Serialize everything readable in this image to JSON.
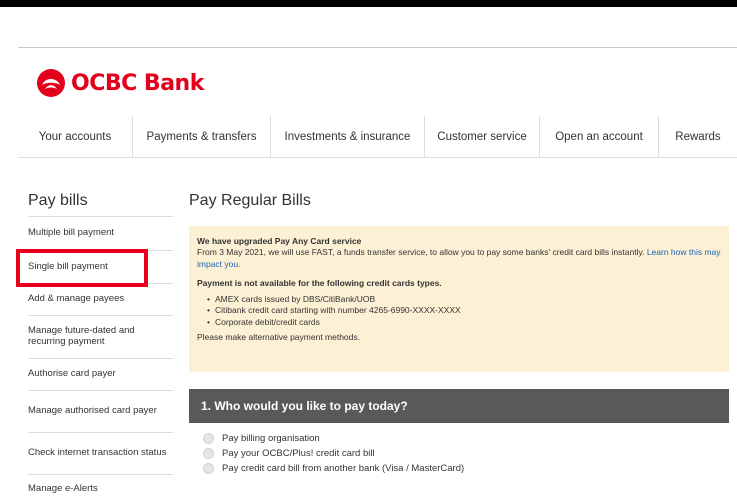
{
  "brand": {
    "name": "OCBC Bank",
    "color": "#e3001b"
  },
  "nav": {
    "items": [
      "Your accounts",
      "Payments & transfers",
      "Investments & insurance",
      "Customer service",
      "Open an account",
      "Rewards"
    ]
  },
  "sidebar": {
    "title": "Pay bills",
    "items": [
      "Multiple bill payment",
      "Single bill payment",
      "Add & manage payees",
      "Manage future-dated and recurring payment",
      "Authorise card payer",
      "Manage authorised card payer",
      "Check internet transaction status",
      "Manage e-Alerts"
    ]
  },
  "main": {
    "title": "Pay Regular Bills",
    "notice": {
      "heading": "We have upgraded Pay Any Card service",
      "body": "From 3 May 2021, we will use FAST, a funds transfer service, to allow you to pay some banks' credit card bills instantly.",
      "link": "Learn how this may impact you.",
      "unavailable_heading": "Payment is not available for the following credit cards types.",
      "bullets": [
        "AMEX cards issued by DBS/CitiBank/UOB",
        "Citibank credit card starting with number 4265-6990-XXXX-XXXX",
        "Corporate debit/credit cards"
      ],
      "footer": "Please make alternative payment methods."
    },
    "section": {
      "heading": "1. Who would you like to pay today?",
      "options": [
        "Pay billing organisation",
        "Pay your OCBC/Plus! credit card bill",
        "Pay credit card bill from another bank (Visa / MasterCard)"
      ]
    }
  }
}
